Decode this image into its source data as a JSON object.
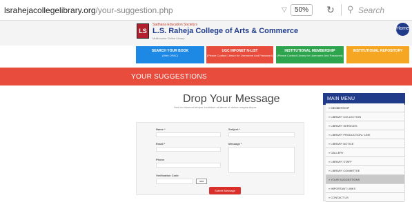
{
  "browser": {
    "url_host": "lsrahejacollegelibrary.org",
    "url_path": "/your-suggestion.php",
    "zoom": "50%",
    "search_placeholder": "Search"
  },
  "header": {
    "society": "Sadhana Education Society's",
    "college": "L.S. Raheja College of Arts & Commerce",
    "subtitle": "Multicourse Online Library",
    "corner_label": "Home"
  },
  "quick_links": [
    {
      "label": "SEARCH YOUR BOOK",
      "sub": "(Web OPAC)",
      "color": "#1e88e5"
    },
    {
      "label": "UGC INFONET N-LIST",
      "sub": "(Please Contact Library for Username And Password)",
      "color": "#e74c3c"
    },
    {
      "label": "INSTITUTIONAL MEMBERSHIP",
      "sub": "(Please Contact Library for Username And Password)",
      "color": "#2ea44f"
    },
    {
      "label": "INSTITUTIONAL REPOSITORY",
      "sub": "",
      "color": "#f5a623"
    }
  ],
  "page_title": "YOUR SUGGESTIONS",
  "main": {
    "heading": "Drop Your Message",
    "subline": "Sed do eiusmod tempor incididunt ut labore et dolore magna aliqua."
  },
  "form": {
    "name_label": "Name *",
    "subject_label": "Subject *",
    "email_label": "Email *",
    "message_label": "Message *",
    "phone_label": "Phone",
    "verification_label": "Verification Code",
    "refresh_label": "NEW",
    "submit_label": "Submit Message"
  },
  "sidebar": {
    "title": "MAIN MENU",
    "items": [
      "» MEMBERSHIP",
      "» LIBRARY COLLECTION",
      "» LIBRARY SERVICES",
      "» LIBRARY PRODUCTION / LINK",
      "» LIBRARY NOTICE",
      "» GALLERY",
      "» LIBRARY STAFF",
      "» LIBRARY COMMITTEE",
      "» YOUR SUGGESTIONS",
      "» IMPORTANT LINKS",
      "» CONTACT US"
    ],
    "active_index": 8
  },
  "colors": {
    "brand_blue": "#1f3b8a",
    "banner_red": "#e74c3c",
    "submit_red": "#d9302c"
  }
}
